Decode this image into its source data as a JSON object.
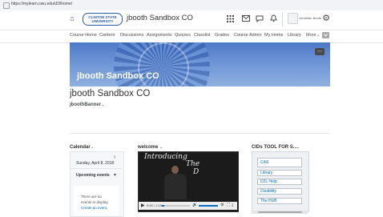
{
  "browser": {
    "url": "https://mylearn.cwu.edu/d2l/home/"
  },
  "header": {
    "logo_line1": "CLINTON STATE",
    "logo_line2": "UNIVERSITY",
    "course_title": "jbooth Sandbox CO",
    "username": "Jonathan Booth"
  },
  "nav": {
    "items": [
      "Course Home",
      "Content",
      "Discussions",
      "Assignments",
      "Quizzes",
      "Classlist",
      "Grades",
      "Course Admin",
      "My Home",
      "Library"
    ],
    "more_label": "More",
    "chevron": "⌄"
  },
  "banner": {
    "title": "jbooth Sandbox CO",
    "menu_glyph": "⋯",
    "color": "#5b86cf"
  },
  "page": {
    "title": "jbooth Sandbox CO",
    "banner_label": "jboothBanner"
  },
  "calendar": {
    "title": "Calendar",
    "date": "Sunday, April 8, 2018",
    "upcoming_label": "Upcoming events",
    "no_events_line1": "There are no",
    "no_events_line2": "events to display.",
    "create_event": "Create an event."
  },
  "welcome": {
    "title": "welcome",
    "video_word1": "Introducing",
    "video_word2": "The",
    "video_word3": "D",
    "time": "0:00 / 1:19",
    "progress": 0.08,
    "volume": 1.0
  },
  "cids": {
    "title": "CIDs TOOL FOR S...",
    "links": [
      "CAS",
      "Library",
      "D2L Help",
      "Disability",
      "The HUB"
    ]
  },
  "colors": {
    "accent": "#006fbf",
    "banner": "#5b86cf",
    "text": "#333333"
  }
}
